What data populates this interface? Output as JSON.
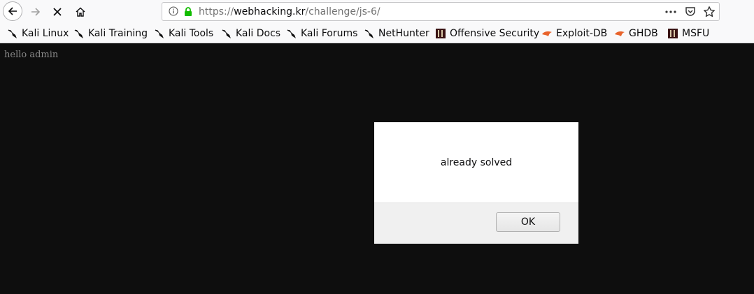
{
  "browser": {
    "url_scheme": "https://",
    "url_host": "webhacking.kr",
    "url_path": "/challenge/js-6/"
  },
  "bookmarks": [
    {
      "label": "Kali Linux",
      "icon": "kali-dragon-icon"
    },
    {
      "label": "Kali Training",
      "icon": "kali-dragon-icon"
    },
    {
      "label": "Kali Tools",
      "icon": "kali-dragon-icon"
    },
    {
      "label": "Kali Docs",
      "icon": "kali-dragon-icon"
    },
    {
      "label": "Kali Forums",
      "icon": "kali-dragon-icon"
    },
    {
      "label": "NetHunter",
      "icon": "kali-dragon-icon"
    },
    {
      "label": "Offensive Security",
      "icon": "offsec-icon"
    },
    {
      "label": "Exploit-DB",
      "icon": "exploitdb-icon"
    },
    {
      "label": "GHDB",
      "icon": "exploitdb-icon"
    },
    {
      "label": "MSFU",
      "icon": "offsec-icon"
    }
  ],
  "page": {
    "text": "hello admin"
  },
  "dialog": {
    "message": "already solved",
    "ok_label": "OK"
  },
  "colors": {
    "page_background": "#0e0e0e",
    "lock_green": "#12bc00"
  }
}
